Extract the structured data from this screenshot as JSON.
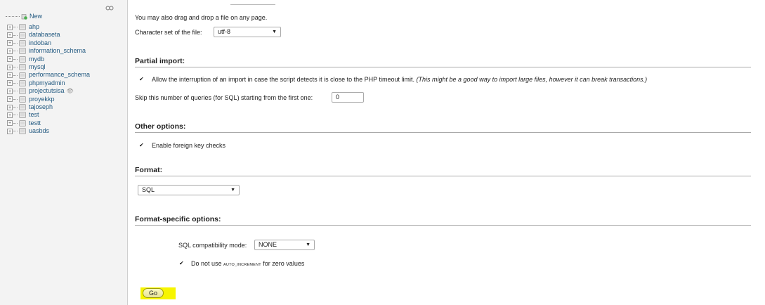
{
  "sidebar": {
    "new_label": "New",
    "databases": [
      {
        "name": "ahp"
      },
      {
        "name": "databaseta"
      },
      {
        "name": "indoban"
      },
      {
        "name": "information_schema"
      },
      {
        "name": "mydb"
      },
      {
        "name": "mysql"
      },
      {
        "name": "performance_schema"
      },
      {
        "name": "phpmyadmin"
      },
      {
        "name": "projectutsisa"
      },
      {
        "name": "proyekkp"
      },
      {
        "name": "tajoseph"
      },
      {
        "name": "test"
      },
      {
        "name": "testt"
      },
      {
        "name": "uasbds"
      }
    ]
  },
  "file": {
    "drag_drop_text": "You may also drag and drop a file on any page.",
    "charset_label": "Character set of the file:",
    "charset_value": "utf-8"
  },
  "partial_import": {
    "heading": "Partial import:",
    "allow_interrupt_text": "Allow the interruption of an import in case the script detects it is close to the PHP timeout limit.",
    "allow_interrupt_note": "(This might be a good way to import large files, however it can break transactions.)",
    "skip_label": "Skip this number of queries (for SQL) starting from the first one:",
    "skip_value": "0"
  },
  "other_options": {
    "heading": "Other options:",
    "foreign_keys_label": "Enable foreign key checks"
  },
  "format": {
    "heading": "Format:",
    "value": "SQL"
  },
  "format_specific": {
    "heading": "Format-specific options:",
    "compat_label": "SQL compatibility mode:",
    "compat_value": "NONE",
    "no_auto_inc_prefix": "Do not use",
    "no_auto_inc_code": "AUTO_INCREMENT",
    "no_auto_inc_suffix": "for zero values"
  },
  "go_label": "Go",
  "colors": {
    "link": "#235a81",
    "highlight": "#f7f500"
  }
}
